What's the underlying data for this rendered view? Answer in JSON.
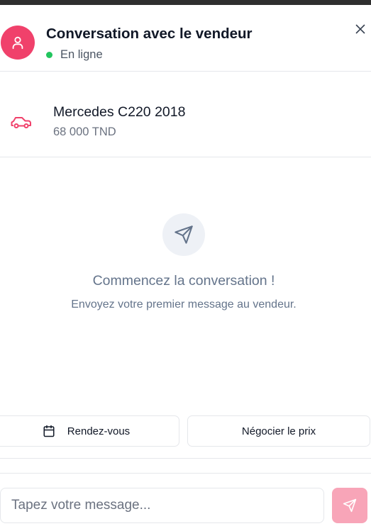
{
  "header": {
    "title": "Conversation avec le vendeur",
    "status": "En ligne",
    "icons": {
      "avatar": "user-icon",
      "close": "close-icon",
      "status": "online-dot"
    }
  },
  "vehicle": {
    "name": "Mercedes C220 2018",
    "price": "68 000 TND",
    "icon": "car-icon"
  },
  "empty_state": {
    "title": "Commencez la conversation !",
    "subtitle": "Envoyez votre premier message au vendeur.",
    "icon": "send-icon"
  },
  "quick_actions": {
    "appointment_label": "Rendez-vous",
    "appointment_icon": "calendar-icon",
    "negotiate_label": "Négocier le prix"
  },
  "composer": {
    "placeholder": "Tapez votre message...",
    "send_icon": "send-icon"
  },
  "colors": {
    "accent": "#f0416b",
    "accent_light": "#f8a5b8",
    "online": "#22c55e",
    "muted_text": "#64748b",
    "border": "#e5e7eb"
  }
}
